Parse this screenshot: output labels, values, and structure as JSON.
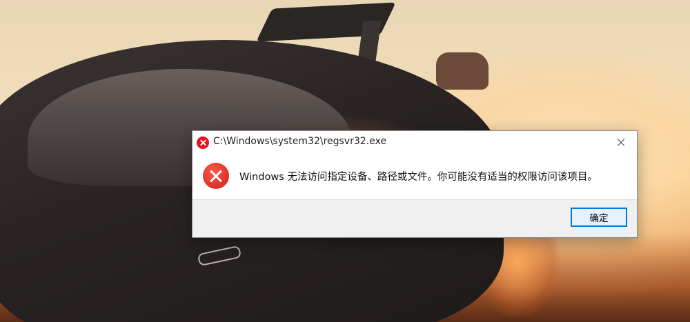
{
  "dialog": {
    "title": "C:\\Windows\\system32\\regsvr32.exe",
    "message": "Windows 无法访问指定设备、路径或文件。你可能没有适当的权限访问该项目。",
    "ok_label": "确定",
    "title_icon": "error-icon",
    "message_icon": "error-icon",
    "close_icon": "close-icon"
  },
  "colors": {
    "error_red": "#e81123",
    "button_accent": "#0078d7"
  }
}
